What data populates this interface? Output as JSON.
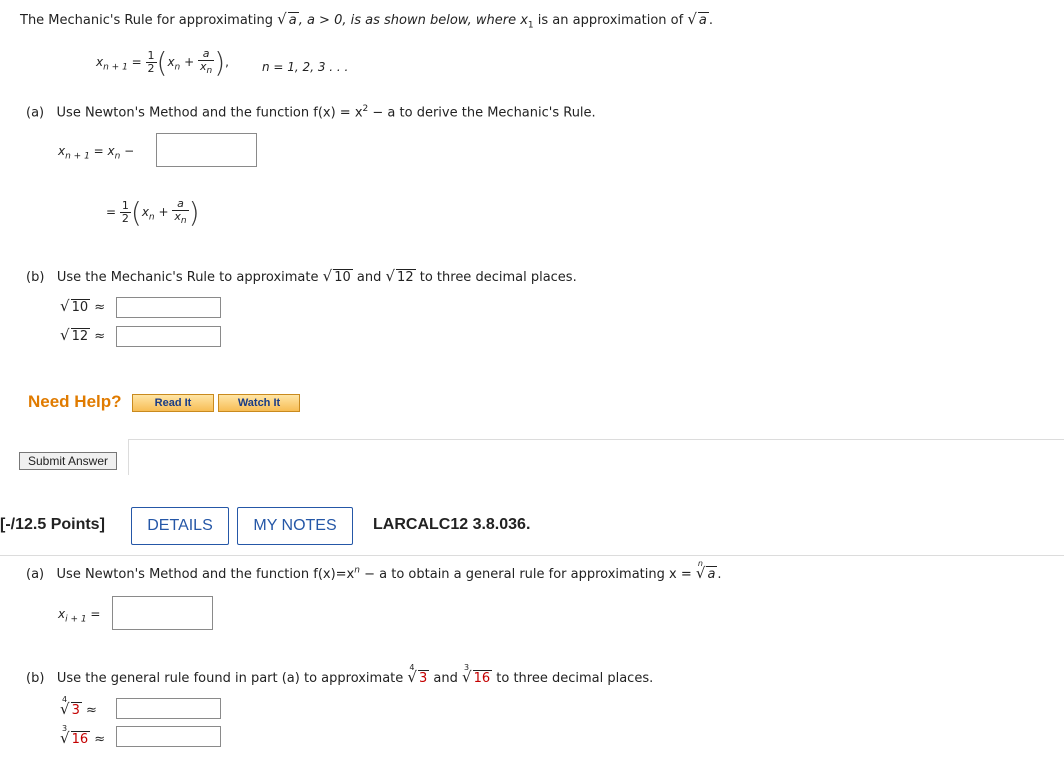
{
  "q1": {
    "intro_pre": "The Mechanic's Rule for approximating",
    "intro_rad": "a",
    "intro_mid": ", a > 0, is as shown below, where x",
    "intro_sub": "1",
    "intro_post": " is an approximation of",
    "intro_rad2": "a",
    "intro_end": ".",
    "rule_n_range": "n = 1, 2, 3 . . .",
    "part_a_label": "(a)",
    "part_a_text_pre": "Use Newton's Method and the function f(x) = x",
    "part_a_text_sup": "2",
    "part_a_text_post": " − a to derive the Mechanic's Rule.",
    "part_b_label": "(b)",
    "part_b_text_pre": "Use the Mechanic's Rule to approximate",
    "part_b_rad1": "10",
    "part_b_and": "and",
    "part_b_rad2": "12",
    "part_b_text_post": "to three decimal places.",
    "sqrt10": "10",
    "sqrt12": "12",
    "approx": "≈",
    "need_help": "Need Help?",
    "read_it": "Read It",
    "watch_it": "Watch It",
    "submit": "Submit Answer"
  },
  "q2": {
    "points": "[-/12.5 Points]",
    "details": "DETAILS",
    "my_notes": "MY NOTES",
    "code": "LARCALC12 3.8.036.",
    "part_a_label": "(a)",
    "part_a_pre": "Use Newton's Method and the function f(x)=x",
    "part_a_sup": "n",
    "part_a_post": " − a to obtain a general rule for approximating x =",
    "part_a_idx": "n",
    "part_a_rad": "a",
    "part_a_end": ".",
    "part_b_label": "(b)",
    "part_b_pre": "Use the general rule found in part (a) to approximate",
    "part_b_idx1": "4",
    "part_b_rad1": "3",
    "part_b_and": "and",
    "part_b_idx2": "3",
    "part_b_rad2": "16",
    "part_b_post": "to three decimal places.",
    "root1_idx": "4",
    "root1_val": "3",
    "root2_idx": "3",
    "root2_val": "16",
    "approx": "≈"
  }
}
